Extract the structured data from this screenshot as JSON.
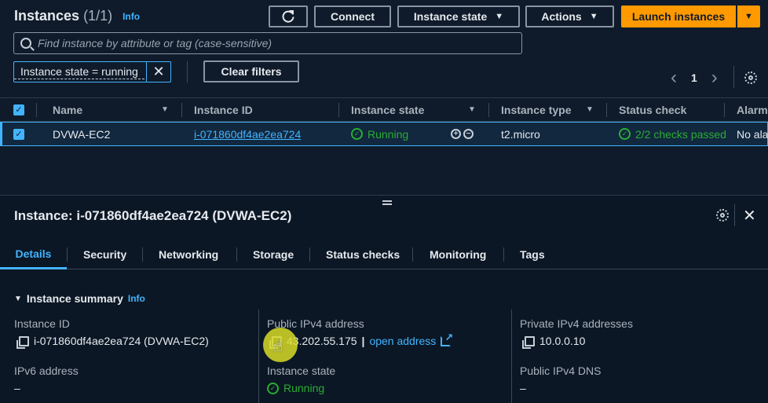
{
  "header": {
    "title": "Instances",
    "count": "(1/1)",
    "info": "Info",
    "buttons": {
      "refresh_icon": "refresh-icon",
      "connect": "Connect",
      "instance_state": "Instance state",
      "actions": "Actions",
      "launch": "Launch instances"
    }
  },
  "search": {
    "placeholder": "Find instance by attribute or tag (case-sensitive)"
  },
  "filters": {
    "token": "Instance state = running",
    "clear": "Clear filters"
  },
  "pagination": {
    "page": "1",
    "prev": "‹",
    "next": "›"
  },
  "table": {
    "columns": [
      "Name",
      "Instance ID",
      "Instance state",
      "Instance type",
      "Status check",
      "Alarm"
    ],
    "rows": [
      {
        "name": "DVWA-EC2",
        "instance_id": "i-071860df4ae2ea724",
        "state": "Running",
        "type": "t2.micro",
        "status_check": "2/2 checks passed",
        "alarm": "No ala"
      }
    ]
  },
  "details": {
    "title": "Instance: i-071860df4ae2ea724 (DVWA-EC2)",
    "tabs": [
      "Details",
      "Security",
      "Networking",
      "Storage",
      "Status checks",
      "Monitoring",
      "Tags"
    ],
    "active_tab": "Details",
    "section": "Instance summary",
    "section_info": "Info",
    "fields": {
      "instance_id_label": "Instance ID",
      "instance_id_value": "i-071860df4ae2ea724 (DVWA-EC2)",
      "ipv6_label": "IPv6 address",
      "ipv6_value": "–",
      "public_ipv4_label": "Public IPv4 address",
      "public_ipv4_value": "43.202.55.175",
      "public_ipv4_sep": "|",
      "open_address": "open address",
      "instance_state_label": "Instance state",
      "instance_state_value": "Running",
      "private_ipv4_label": "Private IPv4 addresses",
      "private_ipv4_value": "10.0.0.10",
      "public_dns_label": "Public IPv4 DNS",
      "public_dns_value": "–"
    }
  },
  "colors": {
    "background": "#0f1b2a",
    "accent": "#42b4ff",
    "primary_button": "#ff9900",
    "success": "#29ad32"
  }
}
